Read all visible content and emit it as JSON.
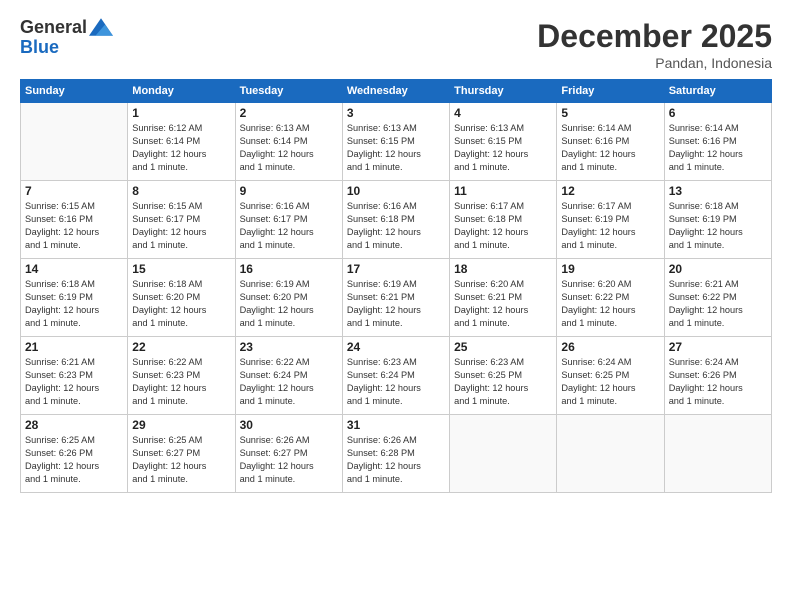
{
  "logo": {
    "general": "General",
    "blue": "Blue"
  },
  "header": {
    "month": "December 2025",
    "location": "Pandan, Indonesia"
  },
  "weekdays": [
    "Sunday",
    "Monday",
    "Tuesday",
    "Wednesday",
    "Thursday",
    "Friday",
    "Saturday"
  ],
  "weeks": [
    [
      {
        "day": "",
        "info": ""
      },
      {
        "day": "1",
        "info": "Sunrise: 6:12 AM\nSunset: 6:14 PM\nDaylight: 12 hours\nand 1 minute."
      },
      {
        "day": "2",
        "info": "Sunrise: 6:13 AM\nSunset: 6:14 PM\nDaylight: 12 hours\nand 1 minute."
      },
      {
        "day": "3",
        "info": "Sunrise: 6:13 AM\nSunset: 6:15 PM\nDaylight: 12 hours\nand 1 minute."
      },
      {
        "day": "4",
        "info": "Sunrise: 6:13 AM\nSunset: 6:15 PM\nDaylight: 12 hours\nand 1 minute."
      },
      {
        "day": "5",
        "info": "Sunrise: 6:14 AM\nSunset: 6:16 PM\nDaylight: 12 hours\nand 1 minute."
      },
      {
        "day": "6",
        "info": "Sunrise: 6:14 AM\nSunset: 6:16 PM\nDaylight: 12 hours\nand 1 minute."
      }
    ],
    [
      {
        "day": "7",
        "info": "Sunrise: 6:15 AM\nSunset: 6:16 PM\nDaylight: 12 hours\nand 1 minute."
      },
      {
        "day": "8",
        "info": "Sunrise: 6:15 AM\nSunset: 6:17 PM\nDaylight: 12 hours\nand 1 minute."
      },
      {
        "day": "9",
        "info": "Sunrise: 6:16 AM\nSunset: 6:17 PM\nDaylight: 12 hours\nand 1 minute."
      },
      {
        "day": "10",
        "info": "Sunrise: 6:16 AM\nSunset: 6:18 PM\nDaylight: 12 hours\nand 1 minute."
      },
      {
        "day": "11",
        "info": "Sunrise: 6:17 AM\nSunset: 6:18 PM\nDaylight: 12 hours\nand 1 minute."
      },
      {
        "day": "12",
        "info": "Sunrise: 6:17 AM\nSunset: 6:19 PM\nDaylight: 12 hours\nand 1 minute."
      },
      {
        "day": "13",
        "info": "Sunrise: 6:18 AM\nSunset: 6:19 PM\nDaylight: 12 hours\nand 1 minute."
      }
    ],
    [
      {
        "day": "14",
        "info": "Sunrise: 6:18 AM\nSunset: 6:19 PM\nDaylight: 12 hours\nand 1 minute."
      },
      {
        "day": "15",
        "info": "Sunrise: 6:18 AM\nSunset: 6:20 PM\nDaylight: 12 hours\nand 1 minute."
      },
      {
        "day": "16",
        "info": "Sunrise: 6:19 AM\nSunset: 6:20 PM\nDaylight: 12 hours\nand 1 minute."
      },
      {
        "day": "17",
        "info": "Sunrise: 6:19 AM\nSunset: 6:21 PM\nDaylight: 12 hours\nand 1 minute."
      },
      {
        "day": "18",
        "info": "Sunrise: 6:20 AM\nSunset: 6:21 PM\nDaylight: 12 hours\nand 1 minute."
      },
      {
        "day": "19",
        "info": "Sunrise: 6:20 AM\nSunset: 6:22 PM\nDaylight: 12 hours\nand 1 minute."
      },
      {
        "day": "20",
        "info": "Sunrise: 6:21 AM\nSunset: 6:22 PM\nDaylight: 12 hours\nand 1 minute."
      }
    ],
    [
      {
        "day": "21",
        "info": "Sunrise: 6:21 AM\nSunset: 6:23 PM\nDaylight: 12 hours\nand 1 minute."
      },
      {
        "day": "22",
        "info": "Sunrise: 6:22 AM\nSunset: 6:23 PM\nDaylight: 12 hours\nand 1 minute."
      },
      {
        "day": "23",
        "info": "Sunrise: 6:22 AM\nSunset: 6:24 PM\nDaylight: 12 hours\nand 1 minute."
      },
      {
        "day": "24",
        "info": "Sunrise: 6:23 AM\nSunset: 6:24 PM\nDaylight: 12 hours\nand 1 minute."
      },
      {
        "day": "25",
        "info": "Sunrise: 6:23 AM\nSunset: 6:25 PM\nDaylight: 12 hours\nand 1 minute."
      },
      {
        "day": "26",
        "info": "Sunrise: 6:24 AM\nSunset: 6:25 PM\nDaylight: 12 hours\nand 1 minute."
      },
      {
        "day": "27",
        "info": "Sunrise: 6:24 AM\nSunset: 6:26 PM\nDaylight: 12 hours\nand 1 minute."
      }
    ],
    [
      {
        "day": "28",
        "info": "Sunrise: 6:25 AM\nSunset: 6:26 PM\nDaylight: 12 hours\nand 1 minute."
      },
      {
        "day": "29",
        "info": "Sunrise: 6:25 AM\nSunset: 6:27 PM\nDaylight: 12 hours\nand 1 minute."
      },
      {
        "day": "30",
        "info": "Sunrise: 6:26 AM\nSunset: 6:27 PM\nDaylight: 12 hours\nand 1 minute."
      },
      {
        "day": "31",
        "info": "Sunrise: 6:26 AM\nSunset: 6:28 PM\nDaylight: 12 hours\nand 1 minute."
      },
      {
        "day": "",
        "info": ""
      },
      {
        "day": "",
        "info": ""
      },
      {
        "day": "",
        "info": ""
      }
    ]
  ]
}
